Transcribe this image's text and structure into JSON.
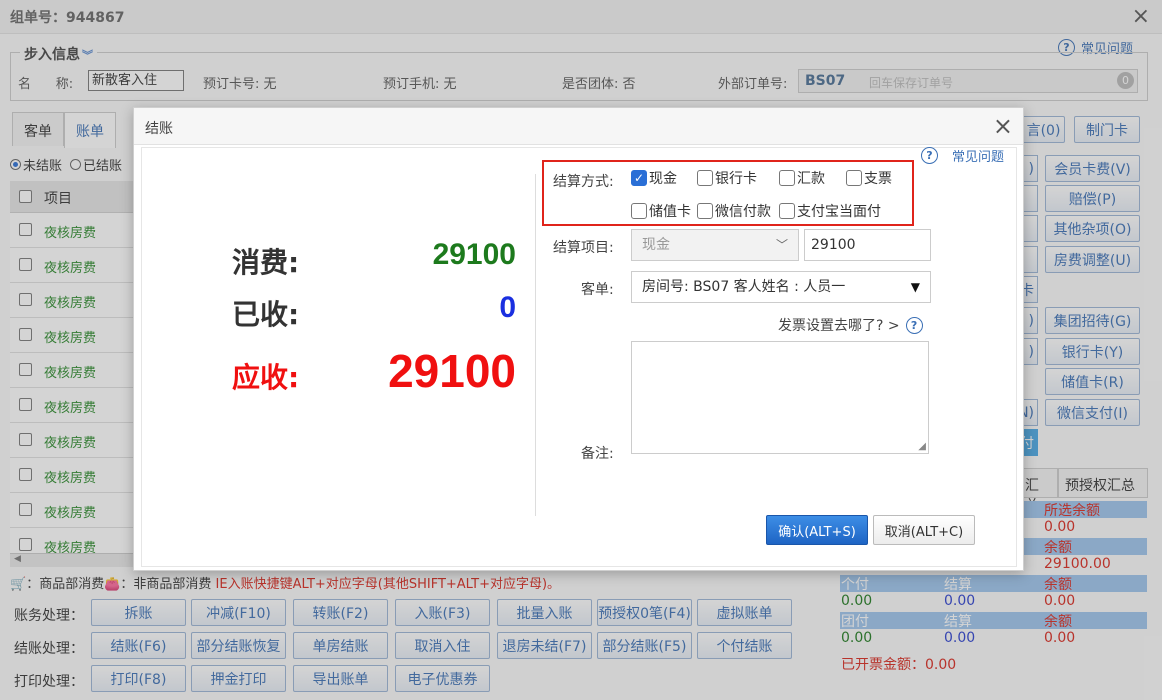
{
  "window": {
    "title": "组单号：944867",
    "close_icon": "×",
    "faq": "常见问题"
  },
  "step_info": {
    "legend": "步入信息",
    "name_label": "名      称:",
    "name_value": "新散客入住",
    "booking_card": "预订卡号: 无",
    "booking_phone": "预订手机: 无",
    "is_group": "是否团体: 否",
    "external_label": "外部订单号:",
    "external_code": "BS07",
    "external_placeholder": "回车保存订单号",
    "external_badge": "0"
  },
  "tabs": [
    "客单",
    "账单"
  ],
  "filter": {
    "unsettled": "未结账",
    "settled": "已结账"
  },
  "table": {
    "header": "项目",
    "rows": [
      "夜核房费",
      "夜核房费",
      "夜核房费",
      "夜核房费",
      "夜核房费",
      "夜核房费",
      "夜核房费",
      "夜核房费",
      "夜核房费",
      "夜核房费"
    ]
  },
  "hint": {
    "part1": "：商品部消费",
    "part2": "：非商品部消费",
    "part3": "IE入账快捷键ALT+对应字母(其他SHIFT+ALT+对应字母)。"
  },
  "actions": {
    "accounting_label": "账务处理：",
    "accounting": [
      "拆账",
      "冲减(F10)",
      "转账(F2)",
      "入账(F3)",
      "批量入账",
      "预授权0笔(F4)",
      "虚拟账单"
    ],
    "settle_label": "结账处理：",
    "settle": [
      "结账(F6)",
      "部分结账恢复",
      "单房结账",
      "取消入住",
      "退房未结(F7)",
      "部分结账(F5)",
      "个付结账"
    ],
    "print_label": "打印处理：",
    "print": [
      "打印(F8)",
      "押金打印",
      "导出账单",
      "电子优惠券"
    ]
  },
  "side_buttons": {
    "top": [
      "言(0)",
      "制门卡"
    ],
    "right": [
      "会员卡费(V)",
      "赔偿(P)",
      "其他杂项(O)",
      "房费调整(U)",
      "集团招待(G)",
      "银行卡(Y)",
      "储值卡(R)",
      "微信支付(I)"
    ],
    "fragments": [
      ")",
      "",
      "",
      "",
      "卡",
      ")",
      ")",
      "",
      "N)",
      "付"
    ]
  },
  "summary": {
    "tab_partial": "汇总",
    "tab_preauth": "预授权汇总",
    "rows": [
      {
        "type": "hdr",
        "c3": "所选余额"
      },
      {
        "type": "val",
        "c3": "0.00"
      },
      {
        "type": "hdr",
        "c3": "余额"
      },
      {
        "type": "val",
        "c3": "29100.00"
      },
      {
        "type": "hdr",
        "c1": "个付",
        "c2": "结算",
        "c3": "余额"
      },
      {
        "type": "val",
        "c1": "0.00",
        "c2": "0.00",
        "c3": "0.00"
      },
      {
        "type": "hdr",
        "c1": "团付",
        "c2": "结算",
        "c3": "余额"
      },
      {
        "type": "val",
        "c1": "0.00",
        "c2": "0.00",
        "c3": "0.00"
      }
    ],
    "invoiced": "已开票金额：0.00"
  },
  "dialog": {
    "title": "结账",
    "close_icon": "×",
    "faq": "常见问题",
    "consume_label": "消费:",
    "consume_value": "29100",
    "received_label": "已收:",
    "received_value": "0",
    "due_label": "应收:",
    "due_value": "29100",
    "method_label": "结算方式:",
    "methods": [
      {
        "label": "现金",
        "checked": true
      },
      {
        "label": "银行卡",
        "checked": false
      },
      {
        "label": "汇款",
        "checked": false
      },
      {
        "label": "支票",
        "checked": false
      },
      {
        "label": "储值卡",
        "checked": false
      },
      {
        "label": "微信付款",
        "checked": false
      },
      {
        "label": "支付宝当面付",
        "checked": false
      }
    ],
    "item_label": "结算项目:",
    "item_value": "现金",
    "amount_value": "29100",
    "guest_label": "客单:",
    "guest_value": "房间号: BS07 客人姓名 : 人员一",
    "invoice_link": "发票设置去哪了? >",
    "remark_label": "备注:",
    "confirm": "确认(ALT+S)",
    "cancel": "取消(ALT+C)"
  },
  "colors": {
    "consume": "#1d7a1d",
    "received": "#1a2fe0",
    "due": "#f01010",
    "accent": "#3a6fb5",
    "highlight_box": "#e0241b"
  }
}
